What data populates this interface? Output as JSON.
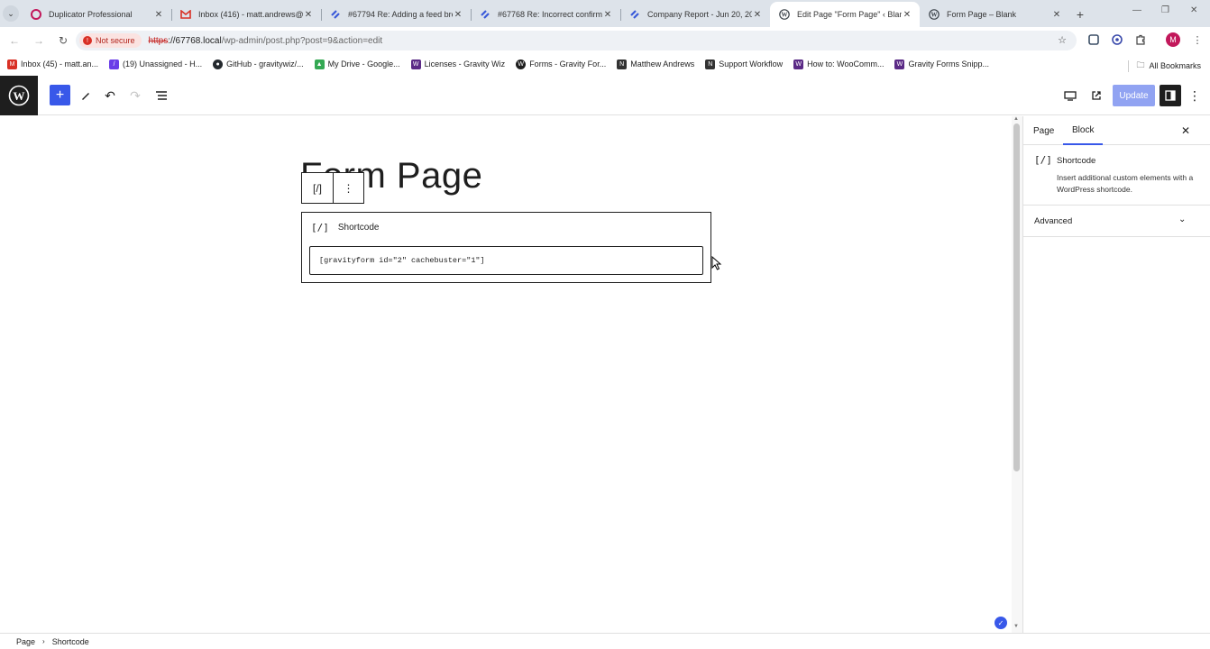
{
  "browser": {
    "tabs": [
      {
        "title": "Duplicator Professional",
        "favicon": "duplicator-icon",
        "active": false
      },
      {
        "title": "Inbox (416) - matt.andrews@g",
        "favicon": "gmail-icon",
        "active": false
      },
      {
        "title": "#67794 Re: Adding a feed brea",
        "favicon": "helpscout-icon",
        "active": false
      },
      {
        "title": "#67768 Re: Incorrect confirmat",
        "favicon": "helpscout-icon",
        "active": false
      },
      {
        "title": "Company Report - Jun 20, 2024",
        "favicon": "helpscout-icon",
        "active": false
      },
      {
        "title": "Edit Page \"Form Page\" ‹ Blank",
        "favicon": "wordpress-icon",
        "active": true
      },
      {
        "title": "Form Page – Blank",
        "favicon": "wordpress-icon",
        "active": false
      }
    ],
    "security_label": "Not secure",
    "url_scheme": "https",
    "url_host": "://67768.local",
    "url_path": "/wp-admin/post.php?post=9&action=edit",
    "profile_initial": "M",
    "bookmarks": [
      {
        "label": "Inbox (45) - matt.an...",
        "icon": "gmail-icon",
        "color": "#d93025"
      },
      {
        "label": "(19) Unassigned - H...",
        "icon": "helpscout-icon",
        "color": "#6a3de8"
      },
      {
        "label": "GitHub - gravitywiz/...",
        "icon": "github-icon",
        "color": "#24292e"
      },
      {
        "label": "My Drive - Google...",
        "icon": "drive-icon",
        "color": "#34a853"
      },
      {
        "label": "Licenses - Gravity Wiz",
        "icon": "gravitywiz-icon",
        "color": "#5b2a86"
      },
      {
        "label": "Forms - Gravity For...",
        "icon": "wordpress-icon",
        "color": "#1e1e1e"
      },
      {
        "label": "Matthew Andrews",
        "icon": "notion-icon",
        "color": "#333333"
      },
      {
        "label": "Support Workflow",
        "icon": "notion-icon",
        "color": "#333333"
      },
      {
        "label": "How to: WooComm...",
        "icon": "gravitywiz-icon",
        "color": "#5b2a86"
      },
      {
        "label": "Gravity Forms Snipp...",
        "icon": "gravitywiz-icon",
        "color": "#5b2a86"
      }
    ],
    "all_bookmarks_label": "All Bookmarks"
  },
  "editor": {
    "update_label": "Update",
    "post_title": "Form Page",
    "block": {
      "toolbar_icon": "[/]",
      "name": "Shortcode",
      "value": "[gravityform id=\"2\" cachebuster=\"1\"]"
    }
  },
  "sidebar": {
    "tabs": [
      "Page",
      "Block"
    ],
    "active_tab": "Block",
    "block_name": "Shortcode",
    "block_description": "Insert additional custom elements with a WordPress shortcode.",
    "advanced_label": "Advanced"
  },
  "footer": {
    "breadcrumb": [
      "Page",
      "Shortcode"
    ]
  },
  "colors": {
    "wp_blue": "#3858e9",
    "wp_dark": "#1e1e1e"
  }
}
